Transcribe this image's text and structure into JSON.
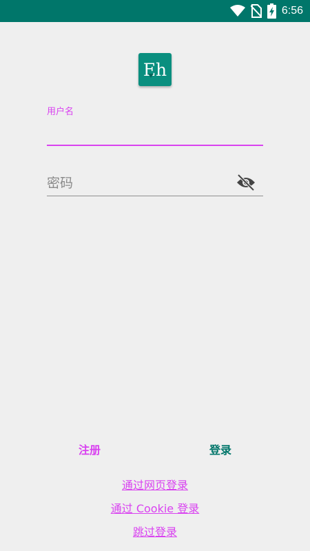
{
  "status_bar": {
    "time": "6:56",
    "icons": [
      "wifi-icon",
      "no-sim-icon",
      "battery-charging-icon"
    ]
  },
  "logo": {
    "text": "Eh"
  },
  "form": {
    "username_label": "用户名",
    "username_value": "",
    "password_placeholder": "密码",
    "password_value": ""
  },
  "actions": {
    "register_label": "注册",
    "login_label": "登录"
  },
  "links": {
    "web_login": "通过网页登录",
    "cookie_login": "通过 Cookie 登录",
    "skip_login": "跳过登录"
  },
  "colors": {
    "primary": "#00766a",
    "accent": "#d942f0",
    "background": "#efefef"
  }
}
